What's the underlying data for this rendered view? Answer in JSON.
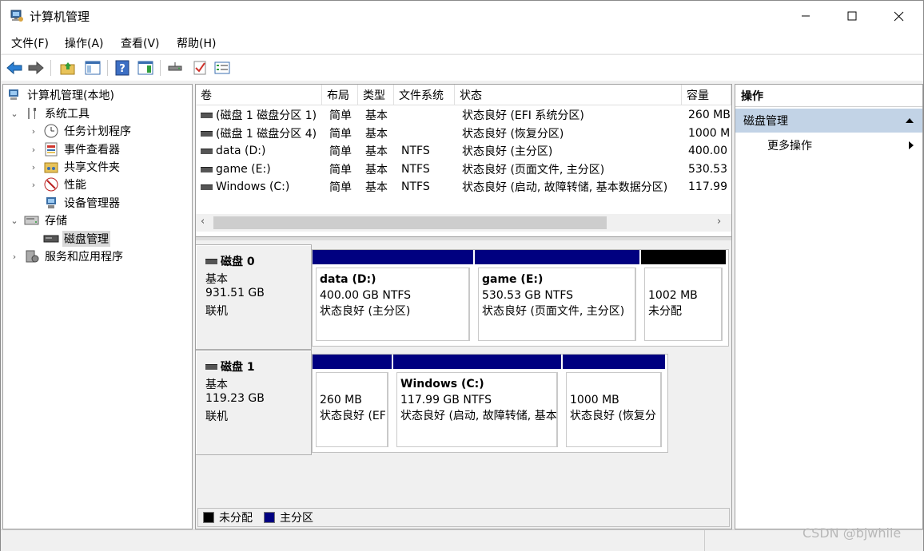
{
  "window": {
    "title": "计算机管理"
  },
  "menus": [
    "文件(F)",
    "操作(A)",
    "查看(V)",
    "帮助(H)"
  ],
  "tree": [
    {
      "label": "计算机管理(本地)",
      "icon": "computer-management-icon"
    },
    {
      "label": "系统工具",
      "icon": "tools-icon",
      "expander": "⌄"
    },
    {
      "label": "任务计划程序",
      "icon": "clock-icon",
      "expander": "›"
    },
    {
      "label": "事件查看器",
      "icon": "event-viewer-icon",
      "expander": "›"
    },
    {
      "label": "共享文件夹",
      "icon": "shared-folder-icon",
      "expander": "›"
    },
    {
      "label": "性能",
      "icon": "performance-icon",
      "expander": "›"
    },
    {
      "label": "设备管理器",
      "icon": "device-manager-icon"
    },
    {
      "label": "存储",
      "icon": "storage-icon",
      "expander": "⌄"
    },
    {
      "label": "磁盘管理",
      "icon": "disk-icon"
    },
    {
      "label": "服务和应用程序",
      "icon": "services-icon",
      "expander": "›"
    }
  ],
  "volumes": {
    "columns": [
      "卷",
      "布局",
      "类型",
      "文件系统",
      "状态",
      "容量"
    ],
    "rows": [
      [
        "(磁盘 1 磁盘分区 1)",
        "简单",
        "基本",
        "",
        "状态良好 (EFI 系统分区)",
        "260 MB"
      ],
      [
        "(磁盘 1 磁盘分区 4)",
        "简单",
        "基本",
        "",
        "状态良好 (恢复分区)",
        "1000 M"
      ],
      [
        "data (D:)",
        "简单",
        "基本",
        "NTFS",
        "状态良好 (主分区)",
        "400.00"
      ],
      [
        "game (E:)",
        "简单",
        "基本",
        "NTFS",
        "状态良好 (页面文件, 主分区)",
        "530.53"
      ],
      [
        "Windows (C:)",
        "简单",
        "基本",
        "NTFS",
        "状态良好 (启动, 故障转储, 基本数据分区)",
        "117.99"
      ]
    ]
  },
  "disks": [
    {
      "name": "磁盘 0",
      "type": "基本",
      "size": "931.51 GB",
      "state": "联机",
      "partitions": [
        {
          "title": "data  (D:)",
          "line1": "400.00 GB NTFS",
          "line2": "状态良好 (主分区)",
          "band": "#000080"
        },
        {
          "title": "game  (E:)",
          "line1": "530.53 GB NTFS",
          "line2": "状态良好 (页面文件, 主分区)",
          "band": "#000080"
        },
        {
          "title": "",
          "line1": "1002 MB",
          "line2": "未分配",
          "band": "#000000"
        }
      ]
    },
    {
      "name": "磁盘 1",
      "type": "基本",
      "size": "119.23 GB",
      "state": "联机",
      "partitions": [
        {
          "title": "",
          "line1": "260 MB",
          "line2": "状态良好 (EF",
          "band": "#000080"
        },
        {
          "title": "Windows  (C:)",
          "line1": "117.99 GB NTFS",
          "line2": "状态良好 (启动, 故障转储, 基本",
          "band": "#000080"
        },
        {
          "title": "",
          "line1": "1000 MB",
          "line2": "状态良好 (恢复分",
          "band": "#000080"
        }
      ]
    }
  ],
  "legend": [
    {
      "label": "未分配",
      "color": "#000000"
    },
    {
      "label": "主分区",
      "color": "#000080"
    }
  ],
  "actions": {
    "header": "操作",
    "section": "磁盘管理",
    "item": "更多操作"
  },
  "watermark": "CSDN @bjwhile"
}
